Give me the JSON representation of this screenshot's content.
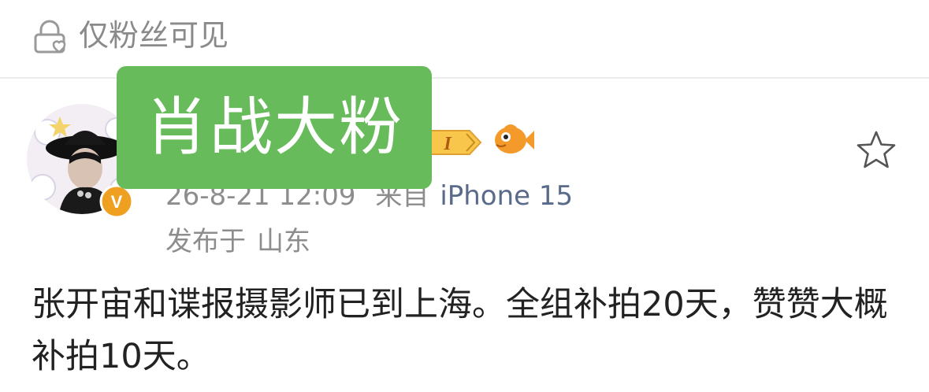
{
  "privacy": {
    "label": "仅粉丝可见",
    "icon": "lock-icon"
  },
  "author": {
    "avatar": "avatar",
    "vip_badge": "V",
    "level_badge": "I",
    "extra_badge": "fish-icon"
  },
  "overlay": {
    "label": "肖战大粉"
  },
  "post": {
    "timestamp": "26-8-21 12:09",
    "source_prefix": "来自",
    "device": "iPhone 15",
    "location_prefix": "发布于",
    "location": "山东",
    "body": "张开宙和谍报摄影师已到上海。全组补拍20天，赞赞大概补拍10天。"
  },
  "actions": {
    "favorite": "star-icon"
  },
  "colors": {
    "overlay_green": "#67bb5a",
    "vip_orange": "#f0a020",
    "meta_gray": "#8d8d8d",
    "device_blue": "#5a6a8a"
  }
}
